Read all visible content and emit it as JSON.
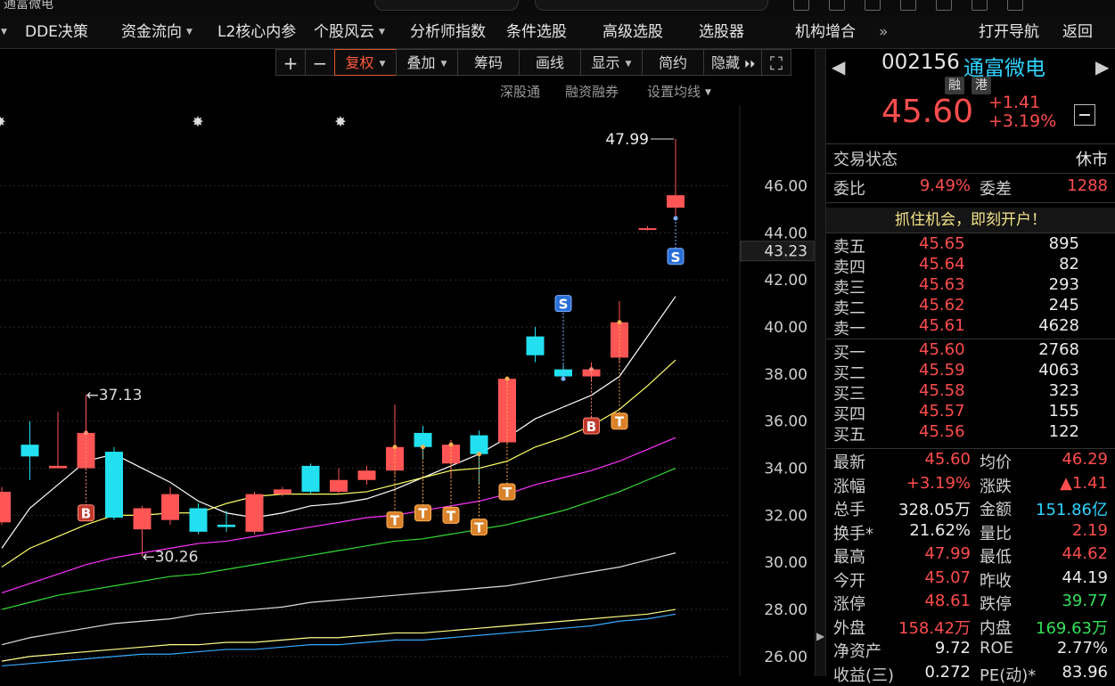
{
  "window": {
    "left_title_fragment": "通富微电"
  },
  "menu": [
    {
      "label": "DDE决策",
      "has_dropdown": false
    },
    {
      "label": "资金流向",
      "has_dropdown": true
    },
    {
      "label": "L2核心内参",
      "has_dropdown": false
    },
    {
      "label": "个股风云",
      "has_dropdown": true
    },
    {
      "label": "分析师指数",
      "has_dropdown": false
    },
    {
      "label": "条件选股",
      "has_dropdown": false
    },
    {
      "label": "高级选股",
      "has_dropdown": false
    },
    {
      "label": "选股器",
      "has_dropdown": false
    },
    {
      "label": "机构增合",
      "has_dropdown": false
    }
  ],
  "menu_more": "»",
  "menu_right": {
    "open_nav": "打开导航",
    "back": "返回"
  },
  "toolbar": {
    "plus": "+",
    "minus": "−",
    "fuquan": "复权",
    "diejia": "叠加",
    "chouma": "筹码",
    "huaxian": "画线",
    "xianshi": "显示",
    "jianyue": "简约",
    "yincang": "隐藏",
    "expand": "⛶"
  },
  "chart_links": {
    "a": "深股通",
    "b": "融资融券",
    "c": "设置均线"
  },
  "chart_data": {
    "type": "candlestick",
    "yaxis_ticks": [
      "46.00",
      "44.00",
      "42.00",
      "40.00",
      "38.00",
      "36.00",
      "34.00",
      "32.00",
      "30.00",
      "28.00",
      "26.00"
    ],
    "ylim": [
      25.2,
      47.99
    ],
    "current_price_label": "43.23",
    "high_label": "47.99",
    "annotation_high": "←37.13",
    "annotation_low": "←30.26",
    "candles": [
      {
        "o": 33.0,
        "c": 31.7,
        "h": 33.2,
        "l": 31.6,
        "dir": "up"
      },
      {
        "o": 34.5,
        "c": 35.0,
        "h": 36.0,
        "l": 33.5,
        "dir": "down"
      },
      {
        "o": 34.0,
        "c": 34.1,
        "h": 36.4,
        "l": 34.0,
        "dir": "up"
      },
      {
        "o": 34.0,
        "c": 35.5,
        "h": 37.13,
        "l": 33.9,
        "dir": "up"
      },
      {
        "o": 34.7,
        "c": 31.9,
        "h": 34.9,
        "l": 31.8,
        "dir": "down"
      },
      {
        "o": 31.4,
        "c": 32.3,
        "h": 32.4,
        "l": 30.26,
        "dir": "up"
      },
      {
        "o": 31.8,
        "c": 32.9,
        "h": 33.2,
        "l": 31.6,
        "dir": "up"
      },
      {
        "o": 32.3,
        "c": 31.3,
        "h": 32.5,
        "l": 31.2,
        "dir": "down"
      },
      {
        "o": 31.6,
        "c": 31.5,
        "h": 32.2,
        "l": 31.3,
        "dir": "down"
      },
      {
        "o": 31.3,
        "c": 32.9,
        "h": 33.0,
        "l": 31.2,
        "dir": "up"
      },
      {
        "o": 32.9,
        "c": 33.1,
        "h": 33.2,
        "l": 32.8,
        "dir": "up"
      },
      {
        "o": 33.0,
        "c": 34.1,
        "h": 34.2,
        "l": 32.9,
        "dir": "down"
      },
      {
        "o": 33.0,
        "c": 33.5,
        "h": 34.0,
        "l": 32.9,
        "dir": "up"
      },
      {
        "o": 33.5,
        "c": 33.9,
        "h": 34.1,
        "l": 33.3,
        "dir": "up"
      },
      {
        "o": 33.9,
        "c": 34.9,
        "h": 36.7,
        "l": 33.7,
        "dir": "up"
      },
      {
        "o": 35.5,
        "c": 34.9,
        "h": 35.8,
        "l": 34.4,
        "dir": "down"
      },
      {
        "o": 34.2,
        "c": 35.0,
        "h": 35.2,
        "l": 33.6,
        "dir": "up"
      },
      {
        "o": 35.4,
        "c": 34.6,
        "h": 35.6,
        "l": 33.3,
        "dir": "down"
      },
      {
        "o": 35.1,
        "c": 37.8,
        "h": 37.8,
        "l": 35.0,
        "dir": "up"
      },
      {
        "o": 39.6,
        "c": 38.8,
        "h": 40.0,
        "l": 38.5,
        "dir": "down"
      },
      {
        "o": 38.2,
        "c": 37.9,
        "h": 38.4,
        "l": 37.8,
        "dir": "down"
      },
      {
        "o": 37.9,
        "c": 38.2,
        "h": 38.5,
        "l": 37.7,
        "dir": "up"
      },
      {
        "o": 38.7,
        "c": 40.2,
        "h": 41.1,
        "l": 38.5,
        "dir": "up"
      },
      {
        "o": 44.2,
        "c": 44.2,
        "h": 44.3,
        "l": 44.1,
        "dir": "up"
      },
      {
        "o": 45.07,
        "c": 45.6,
        "h": 47.99,
        "l": 44.62,
        "dir": "up"
      }
    ],
    "signals": [
      {
        "i": 3,
        "label": "B",
        "at": 32.1,
        "kind": "b"
      },
      {
        "i": 14,
        "label": "T",
        "at": 31.8,
        "kind": "t"
      },
      {
        "i": 15,
        "label": "T",
        "at": 32.1,
        "kind": "t"
      },
      {
        "i": 16,
        "label": "T",
        "at": 32.0,
        "kind": "t"
      },
      {
        "i": 17,
        "label": "T",
        "at": 31.5,
        "kind": "t"
      },
      {
        "i": 18,
        "label": "T",
        "at": 33.0,
        "kind": "t"
      },
      {
        "i": 20,
        "label": "S",
        "at": 41.0,
        "kind": "s"
      },
      {
        "i": 21,
        "label": "B",
        "at": 35.8,
        "kind": "b"
      },
      {
        "i": 22,
        "label": "T",
        "at": 36.0,
        "kind": "t"
      },
      {
        "i": 24,
        "label": "S",
        "at": 43.0,
        "kind": "s"
      }
    ],
    "ma_lines": [
      {
        "color": "#ffffff",
        "values": [
          30.6,
          32.3,
          33.3,
          34.3,
          34.6,
          34.0,
          33.4,
          32.6,
          32.1,
          31.9,
          32.1,
          32.4,
          32.5,
          32.7,
          33.1,
          33.6,
          34.1,
          34.6,
          35.3,
          36.1,
          36.6,
          37.1,
          37.9,
          39.6,
          41.3
        ]
      },
      {
        "color": "#ffff66",
        "values": [
          29.8,
          30.6,
          31.1,
          31.6,
          32.0,
          32.0,
          32.1,
          32.1,
          32.5,
          32.8,
          32.9,
          32.9,
          32.9,
          33.0,
          33.3,
          33.6,
          33.9,
          34.0,
          34.3,
          34.9,
          35.3,
          35.8,
          36.5,
          37.5,
          38.6
        ]
      },
      {
        "color": "#ff33ff",
        "values": [
          28.7,
          29.1,
          29.5,
          29.9,
          30.2,
          30.4,
          30.6,
          30.8,
          30.9,
          31.1,
          31.3,
          31.5,
          31.7,
          31.9,
          32.0,
          32.2,
          32.4,
          32.6,
          32.9,
          33.3,
          33.6,
          33.9,
          34.3,
          34.8,
          35.3
        ]
      },
      {
        "color": "#33dd33",
        "values": [
          28.0,
          28.3,
          28.6,
          28.8,
          29.0,
          29.2,
          29.4,
          29.5,
          29.7,
          29.9,
          30.1,
          30.3,
          30.5,
          30.7,
          30.9,
          31.0,
          31.2,
          31.4,
          31.6,
          31.9,
          32.2,
          32.6,
          33.0,
          33.5,
          34.0
        ]
      },
      {
        "color": "#dddddd",
        "values": [
          26.5,
          26.8,
          27.0,
          27.2,
          27.4,
          27.5,
          27.6,
          27.8,
          27.9,
          28.0,
          28.1,
          28.3,
          28.4,
          28.5,
          28.6,
          28.7,
          28.8,
          28.9,
          29.0,
          29.2,
          29.4,
          29.6,
          29.8,
          30.1,
          30.4
        ]
      },
      {
        "color": "#ffff88",
        "values": [
          25.8,
          26.0,
          26.1,
          26.2,
          26.3,
          26.4,
          26.5,
          26.5,
          26.6,
          26.6,
          26.7,
          26.8,
          26.8,
          26.9,
          27.0,
          27.0,
          27.1,
          27.2,
          27.3,
          27.4,
          27.5,
          27.6,
          27.7,
          27.8,
          28.0
        ]
      },
      {
        "color": "#33aaff",
        "values": [
          25.6,
          25.7,
          25.8,
          25.9,
          26.0,
          26.1,
          26.1,
          26.2,
          26.3,
          26.3,
          26.4,
          26.5,
          26.5,
          26.6,
          26.7,
          26.7,
          26.8,
          26.9,
          27.0,
          27.1,
          27.2,
          27.3,
          27.5,
          27.6,
          27.8
        ]
      }
    ],
    "sun_marks": 3
  },
  "stock": {
    "code": "002156",
    "name": "通富微电",
    "tag1": "融",
    "tag2": "港",
    "price": "45.60",
    "change": "+1.41",
    "change_pct": "+3.19%"
  },
  "status": {
    "label": "交易状态",
    "value": "休市"
  },
  "weibi": {
    "label": "委比",
    "value": "9.49%",
    "diff_label": "委差",
    "diff_value": "1288"
  },
  "promo": "抓住机会，即刻开户！",
  "asks": [
    {
      "label": "卖五",
      "price": "45.65",
      "vol": "895"
    },
    {
      "label": "卖四",
      "price": "45.64",
      "vol": "82"
    },
    {
      "label": "卖三",
      "price": "45.63",
      "vol": "293"
    },
    {
      "label": "卖二",
      "price": "45.62",
      "vol": "245"
    },
    {
      "label": "卖一",
      "price": "45.61",
      "vol": "4628"
    }
  ],
  "bids": [
    {
      "label": "买一",
      "price": "45.60",
      "vol": "2768"
    },
    {
      "label": "买二",
      "price": "45.59",
      "vol": "4063"
    },
    {
      "label": "买三",
      "price": "45.58",
      "vol": "323"
    },
    {
      "label": "买四",
      "price": "45.57",
      "vol": "155"
    },
    {
      "label": "买五",
      "price": "45.56",
      "vol": "122"
    }
  ],
  "stats": [
    {
      "l1": "最新",
      "v1": "45.60",
      "c1": "red",
      "l2": "均价",
      "v2": "46.29",
      "c2": "red"
    },
    {
      "l1": "涨幅",
      "v1": "+3.19%",
      "c1": "red",
      "l2": "涨跌",
      "v2": "▲1.41",
      "c2": "red"
    },
    {
      "l1": "总手",
      "v1": "328.05万",
      "c1": "wht",
      "l2": "金额",
      "v2": "151.86亿",
      "c2": "cyn"
    },
    {
      "l1": "换手*",
      "v1": "21.62%",
      "c1": "wht",
      "l2": "量比",
      "v2": "2.19",
      "c2": "red"
    },
    {
      "l1": "最高",
      "v1": "47.99",
      "c1": "red",
      "l2": "最低",
      "v2": "44.62",
      "c2": "red"
    },
    {
      "l1": "今开",
      "v1": "45.07",
      "c1": "red",
      "l2": "昨收",
      "v2": "44.19",
      "c2": "wht"
    },
    {
      "l1": "涨停",
      "v1": "48.61",
      "c1": "red",
      "l2": "跌停",
      "v2": "39.77",
      "c2": "grn"
    },
    {
      "l1": "外盘",
      "v1": "158.42万",
      "c1": "red",
      "l2": "内盘",
      "v2": "169.63万",
      "c2": "grn"
    },
    {
      "l1": "净资产",
      "v1": "9.72",
      "c1": "wht",
      "l2": "ROE",
      "v2": "2.77%",
      "c2": "wht"
    },
    {
      "l1": "收益(三)",
      "v1": "0.272",
      "c1": "wht",
      "l2": "PE(动)*",
      "v2": "83.96",
      "c2": "wht"
    }
  ]
}
